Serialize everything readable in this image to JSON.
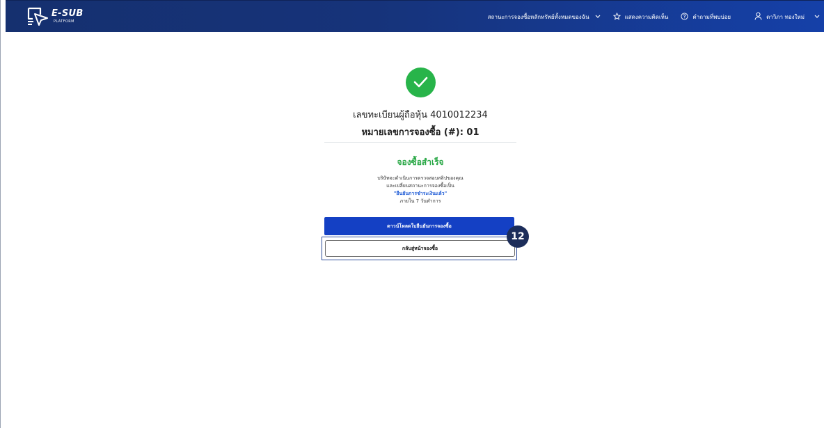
{
  "navbar": {
    "logo_title": "E-SUB",
    "logo_subtitle": "PLATFORM",
    "items": [
      {
        "label": "สถานะการจองซื้อหลักทรัพย์ทั้งหมดของฉัน",
        "icon": "chevron-down-icon"
      },
      {
        "label": "แสดงความคิดเห็น",
        "icon": "star-icon"
      },
      {
        "label": "คำถามที่พบบ่อย",
        "icon": "help-circle-icon"
      },
      {
        "label": "ตาวิภา ทองใหม่",
        "icon": "user-icon"
      }
    ]
  },
  "result": {
    "icon": "check-icon",
    "registration_line": "เลขทะเบียนผู้ถือหุ้น 4010012234",
    "booking_line": "หมายเลขการจองซื้อ (#): 01",
    "success_title": "จองซื้อสำเร็จ",
    "desc_line1": "บริษัทจะดำเนินการตรวจสอบสลิปของคุณ",
    "desc_line2": "และเปลี่ยนสถานะการจองซื้อเป็น",
    "desc_status": "\"ยืนยันการชำระเงินแล้ว\"",
    "desc_line4": "ภายใน 7 วันทำการ"
  },
  "actions": {
    "download_label": "ดาวน์โหลดใบยืนยันการจองซื้อ",
    "back_label": "กลับสู่หน้าจองซื้อ"
  },
  "annotation": {
    "step_number": "12"
  },
  "colors": {
    "navbar": "#16337a",
    "success_green": "#28b44a",
    "primary_button": "#1440c4",
    "status_link": "#1e5bd6",
    "step_badge": "#1c2d5a"
  }
}
